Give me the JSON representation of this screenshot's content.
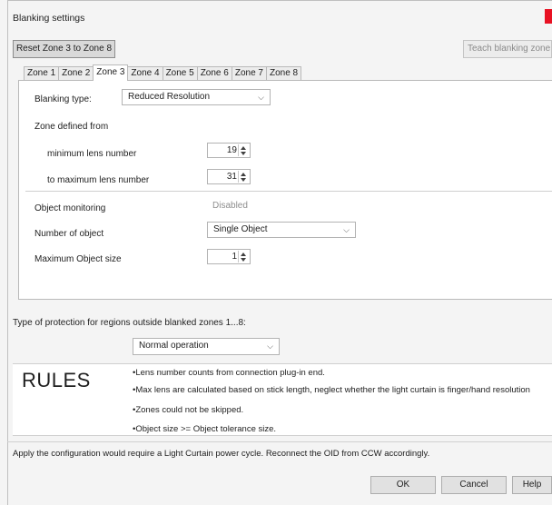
{
  "window": {
    "title": "Blanking settings"
  },
  "toolbar": {
    "reset_label": "Reset Zone 3 to Zone 8",
    "teach_label": "Teach blanking zone"
  },
  "tabs": [
    {
      "label": "Zone 1",
      "active": false
    },
    {
      "label": "Zone 2",
      "active": false
    },
    {
      "label": "Zone 3",
      "active": true
    },
    {
      "label": "Zone 4",
      "active": false
    },
    {
      "label": "Zone 5",
      "active": false
    },
    {
      "label": "Zone 6",
      "active": false
    },
    {
      "label": "Zone 7",
      "active": false
    },
    {
      "label": "Zone 8",
      "active": false
    }
  ],
  "zone": {
    "blanking_type_label": "Blanking type:",
    "blanking_type_value": "Reduced Resolution",
    "zone_defined_label": "Zone defined from",
    "min_lens_label": "minimum lens number",
    "min_lens_value": "19",
    "max_lens_label": "to maximum lens number",
    "max_lens_value": "31",
    "object_monitoring_label": "Object monitoring",
    "object_monitoring_value": "Disabled",
    "number_of_object_label": "Number of object",
    "number_of_object_value": "Single Object",
    "max_object_size_label": "Maximum Object size",
    "max_object_size_value": "1"
  },
  "protection": {
    "label": "Type of protection for regions outside blanked zones 1...8:",
    "value": "Normal operation"
  },
  "rules": {
    "title": "RULES",
    "items": [
      "•Lens number counts from connection plug-in end.",
      "•Max lens are calculated based on stick length, neglect whether the light curtain is finger/hand resolution",
      "•Zones could not be skipped.",
      "•Object size >= Object tolerance size."
    ]
  },
  "footer": {
    "note": "Apply the configuration would require a Light Curtain power cycle.   Reconnect the OID from CCW accordingly.",
    "ok_label": "OK",
    "cancel_label": "Cancel",
    "help_label": "Help"
  }
}
